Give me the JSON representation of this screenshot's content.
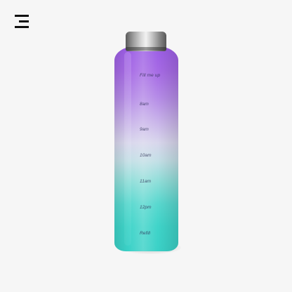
{
  "brand": {
    "logo_icon": "menu-lines-logo-icon"
  },
  "product": {
    "type": "water-bottle",
    "cap_icon": "metal-cap",
    "colors": {
      "top": "#9b5de5",
      "middle": "#d8d6ec",
      "bottom": "#3ad1c7"
    }
  },
  "bottle_marks": [
    "Fill me up",
    "8am",
    "9am",
    "10am",
    "11am",
    "12pm",
    "Refill"
  ]
}
